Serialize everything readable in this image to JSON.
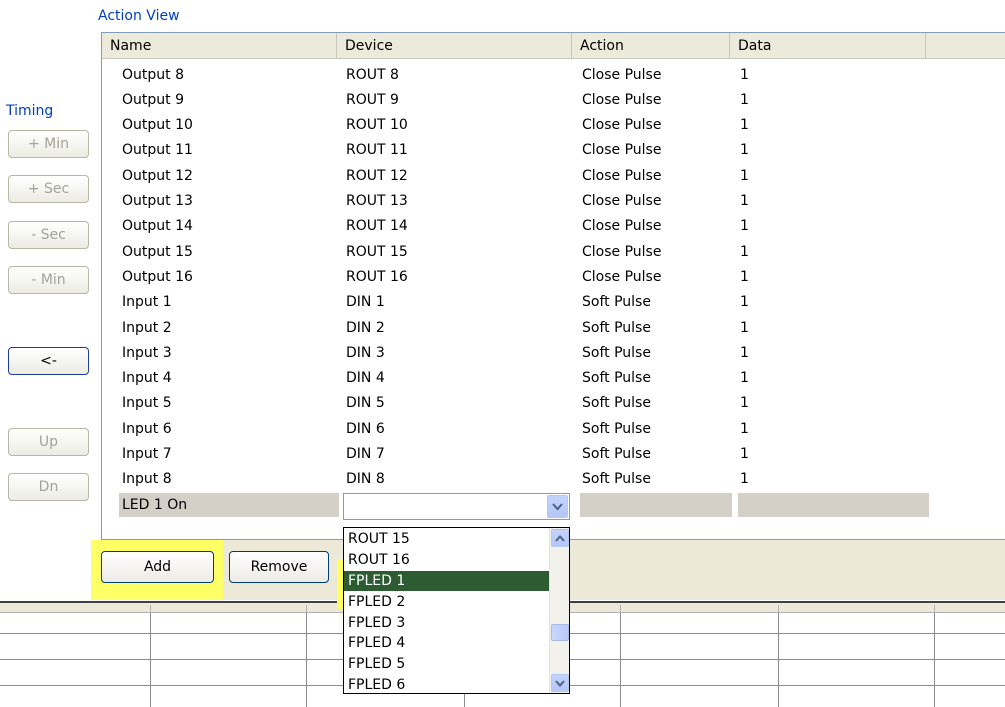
{
  "action_view_title": "Action View",
  "timing": {
    "title": "Timing",
    "buttons": [
      "+ Min",
      "+ Sec",
      "- Sec",
      "- Min"
    ],
    "back_label": "<-",
    "up_label": "Up",
    "down_label": "Dn"
  },
  "columns": [
    "Name",
    "Device",
    "Action",
    "Data"
  ],
  "rows": [
    [
      "Output 8",
      "ROUT 8",
      "Close Pulse",
      "1"
    ],
    [
      "Output 9",
      "ROUT 9",
      "Close Pulse",
      "1"
    ],
    [
      "Output 10",
      "ROUT 10",
      "Close Pulse",
      "1"
    ],
    [
      "Output 11",
      "ROUT 11",
      "Close Pulse",
      "1"
    ],
    [
      "Output 12",
      "ROUT 12",
      "Close Pulse",
      "1"
    ],
    [
      "Output 13",
      "ROUT 13",
      "Close Pulse",
      "1"
    ],
    [
      "Output 14",
      "ROUT 14",
      "Close Pulse",
      "1"
    ],
    [
      "Output 15",
      "ROUT 15",
      "Close Pulse",
      "1"
    ],
    [
      "Output 16",
      "ROUT 16",
      "Close Pulse",
      "1"
    ],
    [
      "Input 1",
      "DIN 1",
      "Soft Pulse",
      "1"
    ],
    [
      "Input 2",
      "DIN 2",
      "Soft Pulse",
      "1"
    ],
    [
      "Input 3",
      "DIN 3",
      "Soft Pulse",
      "1"
    ],
    [
      "Input 4",
      "DIN 4",
      "Soft Pulse",
      "1"
    ],
    [
      "Input 5",
      "DIN 5",
      "Soft Pulse",
      "1"
    ],
    [
      "Input 6",
      "DIN 6",
      "Soft Pulse",
      "1"
    ],
    [
      "Input 7",
      "DIN 7",
      "Soft Pulse",
      "1"
    ],
    [
      "Input 8",
      "DIN 8",
      "Soft Pulse",
      "1"
    ]
  ],
  "edit_row": {
    "name": "LED 1 On",
    "device_value": ""
  },
  "dropdown": {
    "items": [
      "ROUT 15",
      "ROUT 16",
      "FPLED 1",
      "FPLED 2",
      "FPLED 3",
      "FPLED 4",
      "FPLED 5",
      "FPLED 6"
    ],
    "selected": "FPLED 1"
  },
  "buttons": {
    "add": "Add",
    "remove": "Remove"
  },
  "colors": {
    "highlight": "#ffff66",
    "selection": "#2d5b32",
    "label_blue": "#0040c0"
  }
}
